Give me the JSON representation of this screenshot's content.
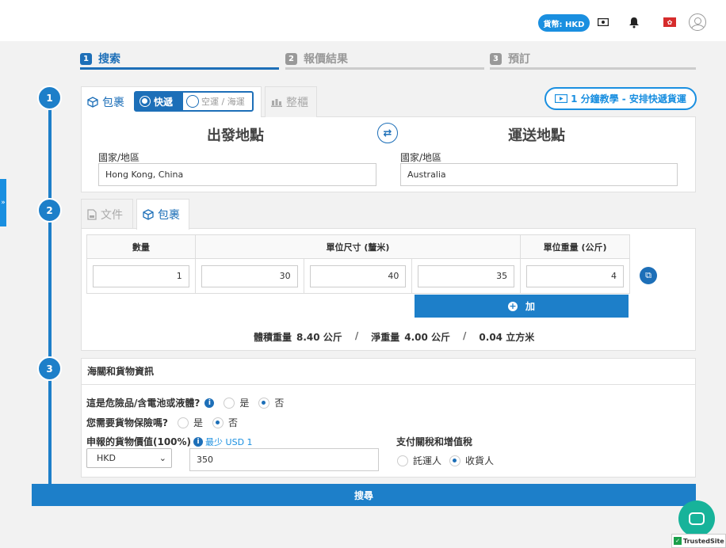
{
  "header": {
    "currency_badge": "貨幣: HKD",
    "icons": [
      "cash-icon",
      "bell-icon",
      "flag-icon",
      "user-icon"
    ]
  },
  "steps": [
    {
      "num": "1",
      "label": "搜索"
    },
    {
      "num": "2",
      "label": "報價結果"
    },
    {
      "num": "3",
      "label": "預訂"
    }
  ],
  "timeline": {
    "s1": "1",
    "s2": "2",
    "s3": "3"
  },
  "section1": {
    "tab_parcel": "包裹",
    "toggle_express": "快遞",
    "toggle_air_sea": "空運 / 海運",
    "tab_pallet": "整櫃",
    "tutorial": "1 分鐘教學 - 安排快遞貨運",
    "origin_title": "出發地點",
    "dest_title": "運送地點",
    "origin_label": "國家/地區",
    "origin_value": "Hong Kong, China",
    "dest_label": "國家/地區",
    "dest_value": "Australia"
  },
  "section2": {
    "tab_document": "文件",
    "tab_parcel": "包裹",
    "col_qty": "數量",
    "col_dims": "單位尺寸 (釐米)",
    "col_weight": "單位重量 (公斤)",
    "qty": "1",
    "length": "30",
    "width": "40",
    "height": "35",
    "weight": "4",
    "add_label": "加",
    "vol_weight_label": "體積重量",
    "vol_weight_value": "8.40 公斤",
    "net_weight_label": "淨重量",
    "net_weight_value": "4.00 公斤",
    "volume_value": "0.04 立方米",
    "separator": "/"
  },
  "section3": {
    "title": "海關和貨物資訊",
    "dangerous_q": "這是危險品/含電池或液體?",
    "insurance_q": "您需要貨物保險嗎?",
    "yes": "是",
    "no": "否",
    "declared_label": "申報的貨物價值(100%)",
    "min_note": "最少 USD 1",
    "currency_select": "HKD",
    "declared_value": "350",
    "duty_label": "支付關稅和增值稅",
    "shipper": "託運人",
    "receiver": "收貨人"
  },
  "search_button": "搜尋",
  "trusted": "TrustedSite"
}
